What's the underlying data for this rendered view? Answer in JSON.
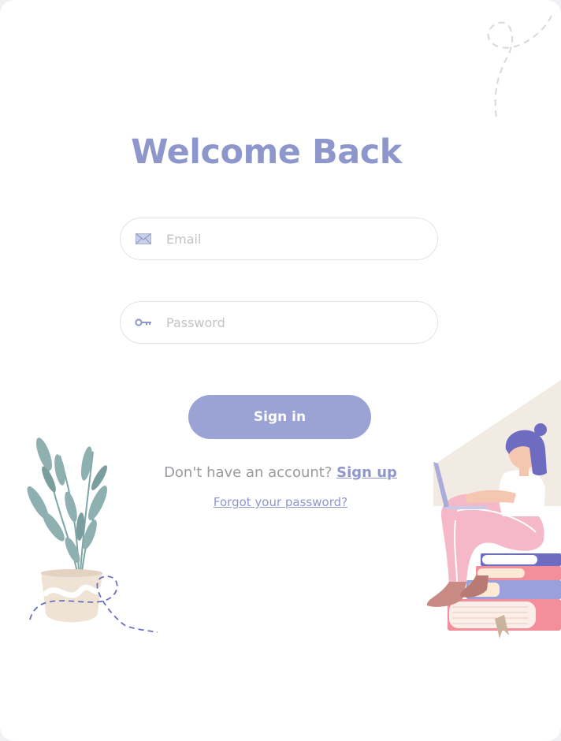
{
  "header": {
    "title": "Welcome Back"
  },
  "form": {
    "email": {
      "placeholder": "Email",
      "value": "",
      "icon": "envelope-icon"
    },
    "password": {
      "placeholder": "Password",
      "value": "",
      "icon": "key-icon"
    },
    "signin_label": "Sign in"
  },
  "footer": {
    "signup_prompt": "Don't have an account?",
    "signup_link": "Sign up",
    "forgot_link": "Forgot your password?"
  },
  "illustrations": {
    "plant": "potted-plant-illustration",
    "reader": "woman-with-laptop-on-books-illustration"
  },
  "colors": {
    "accent": "#8e97cc",
    "button": "#9aa3d4",
    "muted_text": "#9a9aa0",
    "field_border": "#e3e3e6"
  }
}
